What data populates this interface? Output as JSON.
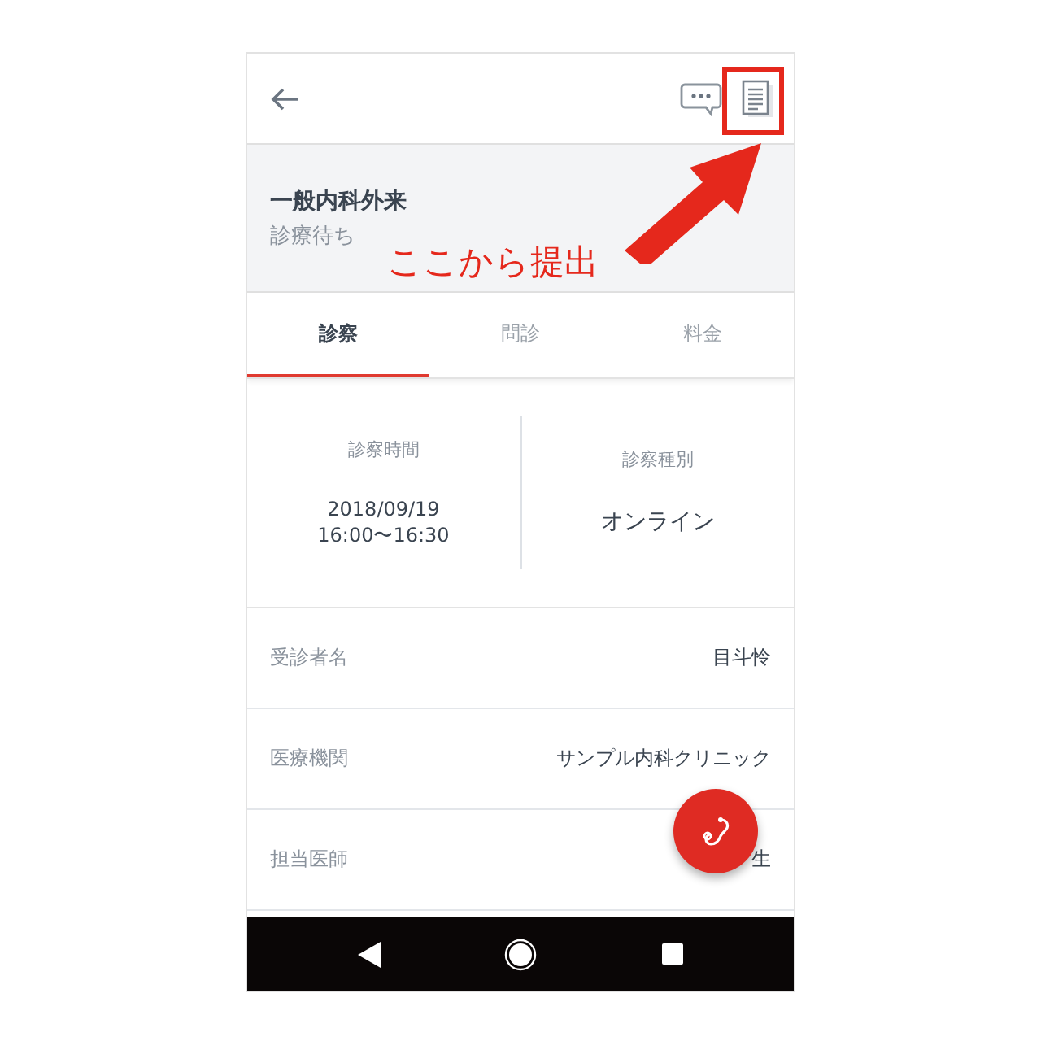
{
  "visit": {
    "title": "一般内科外来",
    "status": "診療待ち"
  },
  "tabs": [
    {
      "label": "診察",
      "selected": true
    },
    {
      "label": "問診",
      "selected": false
    },
    {
      "label": "料金",
      "selected": false
    }
  ],
  "summary": [
    {
      "label": "診察時間",
      "lines": [
        "2018/09/19",
        "16:00〜16:30"
      ]
    },
    {
      "label": "診察種別",
      "lines": [
        "オンライン"
      ]
    }
  ],
  "details": [
    {
      "label": "受診者名",
      "value": "目斗怜"
    },
    {
      "label": "医療機関",
      "value": "サンプル内科クリニック"
    },
    {
      "label": "担当医師",
      "value": "生"
    }
  ],
  "annotation": {
    "text": "ここから提出"
  }
}
